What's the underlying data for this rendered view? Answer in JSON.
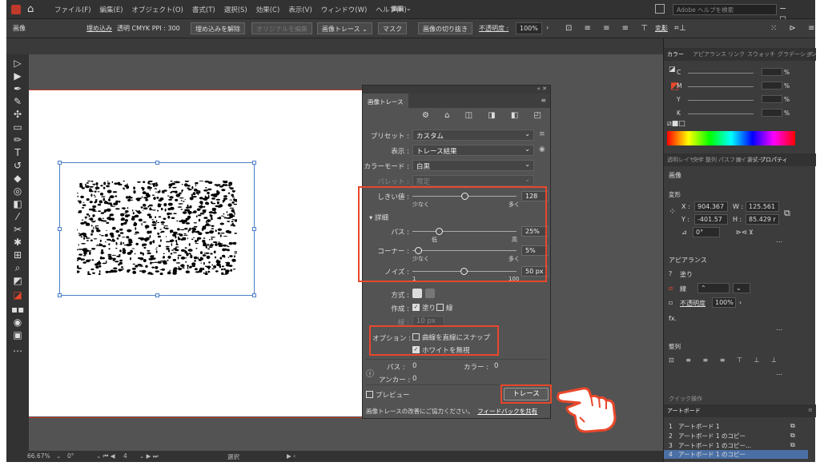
{
  "menubar": {
    "items": [
      "ファイル(F)",
      "編集(E)",
      "オブジェクト(O)",
      "書式(T)",
      "選択(S)",
      "効果(C)",
      "表示(V)",
      "ウィンドウ(W)",
      "ヘルプ(H)"
    ],
    "search_placeholder": "Adobe ヘルプを検索",
    "window_controls": "− ◻ ✕"
  },
  "ctrlbar": {
    "label": "画像",
    "embedded": "埋め込み",
    "info": "透明 CMYK  PPI : 300",
    "unembed": "埋め込みを解除",
    "edit_original": "オリジナルを編集",
    "image_trace": "画像トレース",
    "mask": "マスク",
    "crop": "画像の切り抜き",
    "opacity_label": "不透明度 :",
    "opacity_value": "100%",
    "properties": "変形"
  },
  "statusbar": {
    "zoom": "66.67%",
    "rotation": "0°",
    "artboard": "4",
    "mode": "選択"
  },
  "color_panel": {
    "tabs": [
      "カラー",
      "アピアランス",
      "リンク",
      "スウォッチ",
      "グラデーション"
    ],
    "rows": [
      {
        "label": "C",
        "pct": "%"
      },
      {
        "label": "M",
        "pct": "%"
      },
      {
        "label": "Y",
        "pct": "%"
      },
      {
        "label": "K",
        "pct": "%"
      }
    ]
  },
  "properties_panel": {
    "tabs": [
      "透明",
      "レイヤー",
      "文字",
      "整列",
      "パスファインダー",
      "線",
      "書式",
      "プロパティ"
    ],
    "section_image": "画像",
    "section_transform": "変形",
    "x_label": "X :",
    "x_value": "904.367",
    "y_label": "Y :",
    "y_value": "-401.57",
    "w_label": "W :",
    "w_value": "125.561",
    "h_label": "H :",
    "h_value": "85.429 r",
    "angle": "0°",
    "section_appearance": "アピアランス",
    "fill_label": "塗り",
    "stroke_label": "線",
    "opacity_label": "不透明度",
    "opacity_value": "100%",
    "fx": "fx.",
    "section_align": "整列",
    "quick_actions": "クイック操作"
  },
  "artboards_panel": {
    "title": "アートボード",
    "items": [
      {
        "num": "1",
        "name": "アートボード 1"
      },
      {
        "num": "2",
        "name": "アートボード 1 のコピー"
      },
      {
        "num": "3",
        "name": "アートボード 1 のコピー..."
      },
      {
        "num": "4",
        "name": "アートボード 1 のコピー"
      }
    ]
  },
  "trace_dialog": {
    "tab": "画像トレース",
    "preset_label": "プリセット :",
    "preset_value": "カスタム",
    "view_label": "表示 :",
    "view_value": "トレース結果",
    "mode_label": "カラーモード :",
    "mode_value": "白黒",
    "palette_label": "パレット :",
    "palette_value": "限定",
    "threshold_label": "しきい値 :",
    "threshold_value": "128",
    "threshold_min": "少なく",
    "threshold_max": "多く",
    "details_label": "▾ 詳細",
    "paths_label": "パス :",
    "paths_value": "25%",
    "paths_min": "低",
    "paths_max": "高",
    "corners_label": "コーナー :",
    "corners_value": "5%",
    "corners_min": "少なく",
    "corners_max": "多く",
    "noise_label": "ノイズ :",
    "noise_value": "50 px",
    "noise_min": "1",
    "noise_max": "100",
    "method_label": "方式 :",
    "create_label": "作成 :",
    "create_fill": "塗り",
    "create_stroke": "線",
    "stroke_label": "線 :",
    "stroke_value": "10 px",
    "options_label": "オプション :",
    "snap_label": "曲線を直線にスナップ",
    "ignore_white_label": "ホワイトを無視",
    "paths_info_label": "パス :",
    "paths_info_value": "0",
    "colors_info_label": "カラー :",
    "colors_info_value": "0",
    "anchors_info_label": "アンカー :",
    "anchors_info_value": "0",
    "preview_label": "プレビュー",
    "trace_button": "トレース",
    "feedback_text": "画像トレースの改善にご協力ください。",
    "feedback_link": "フィードバックを共有"
  },
  "highlight_color": "#e8472b"
}
